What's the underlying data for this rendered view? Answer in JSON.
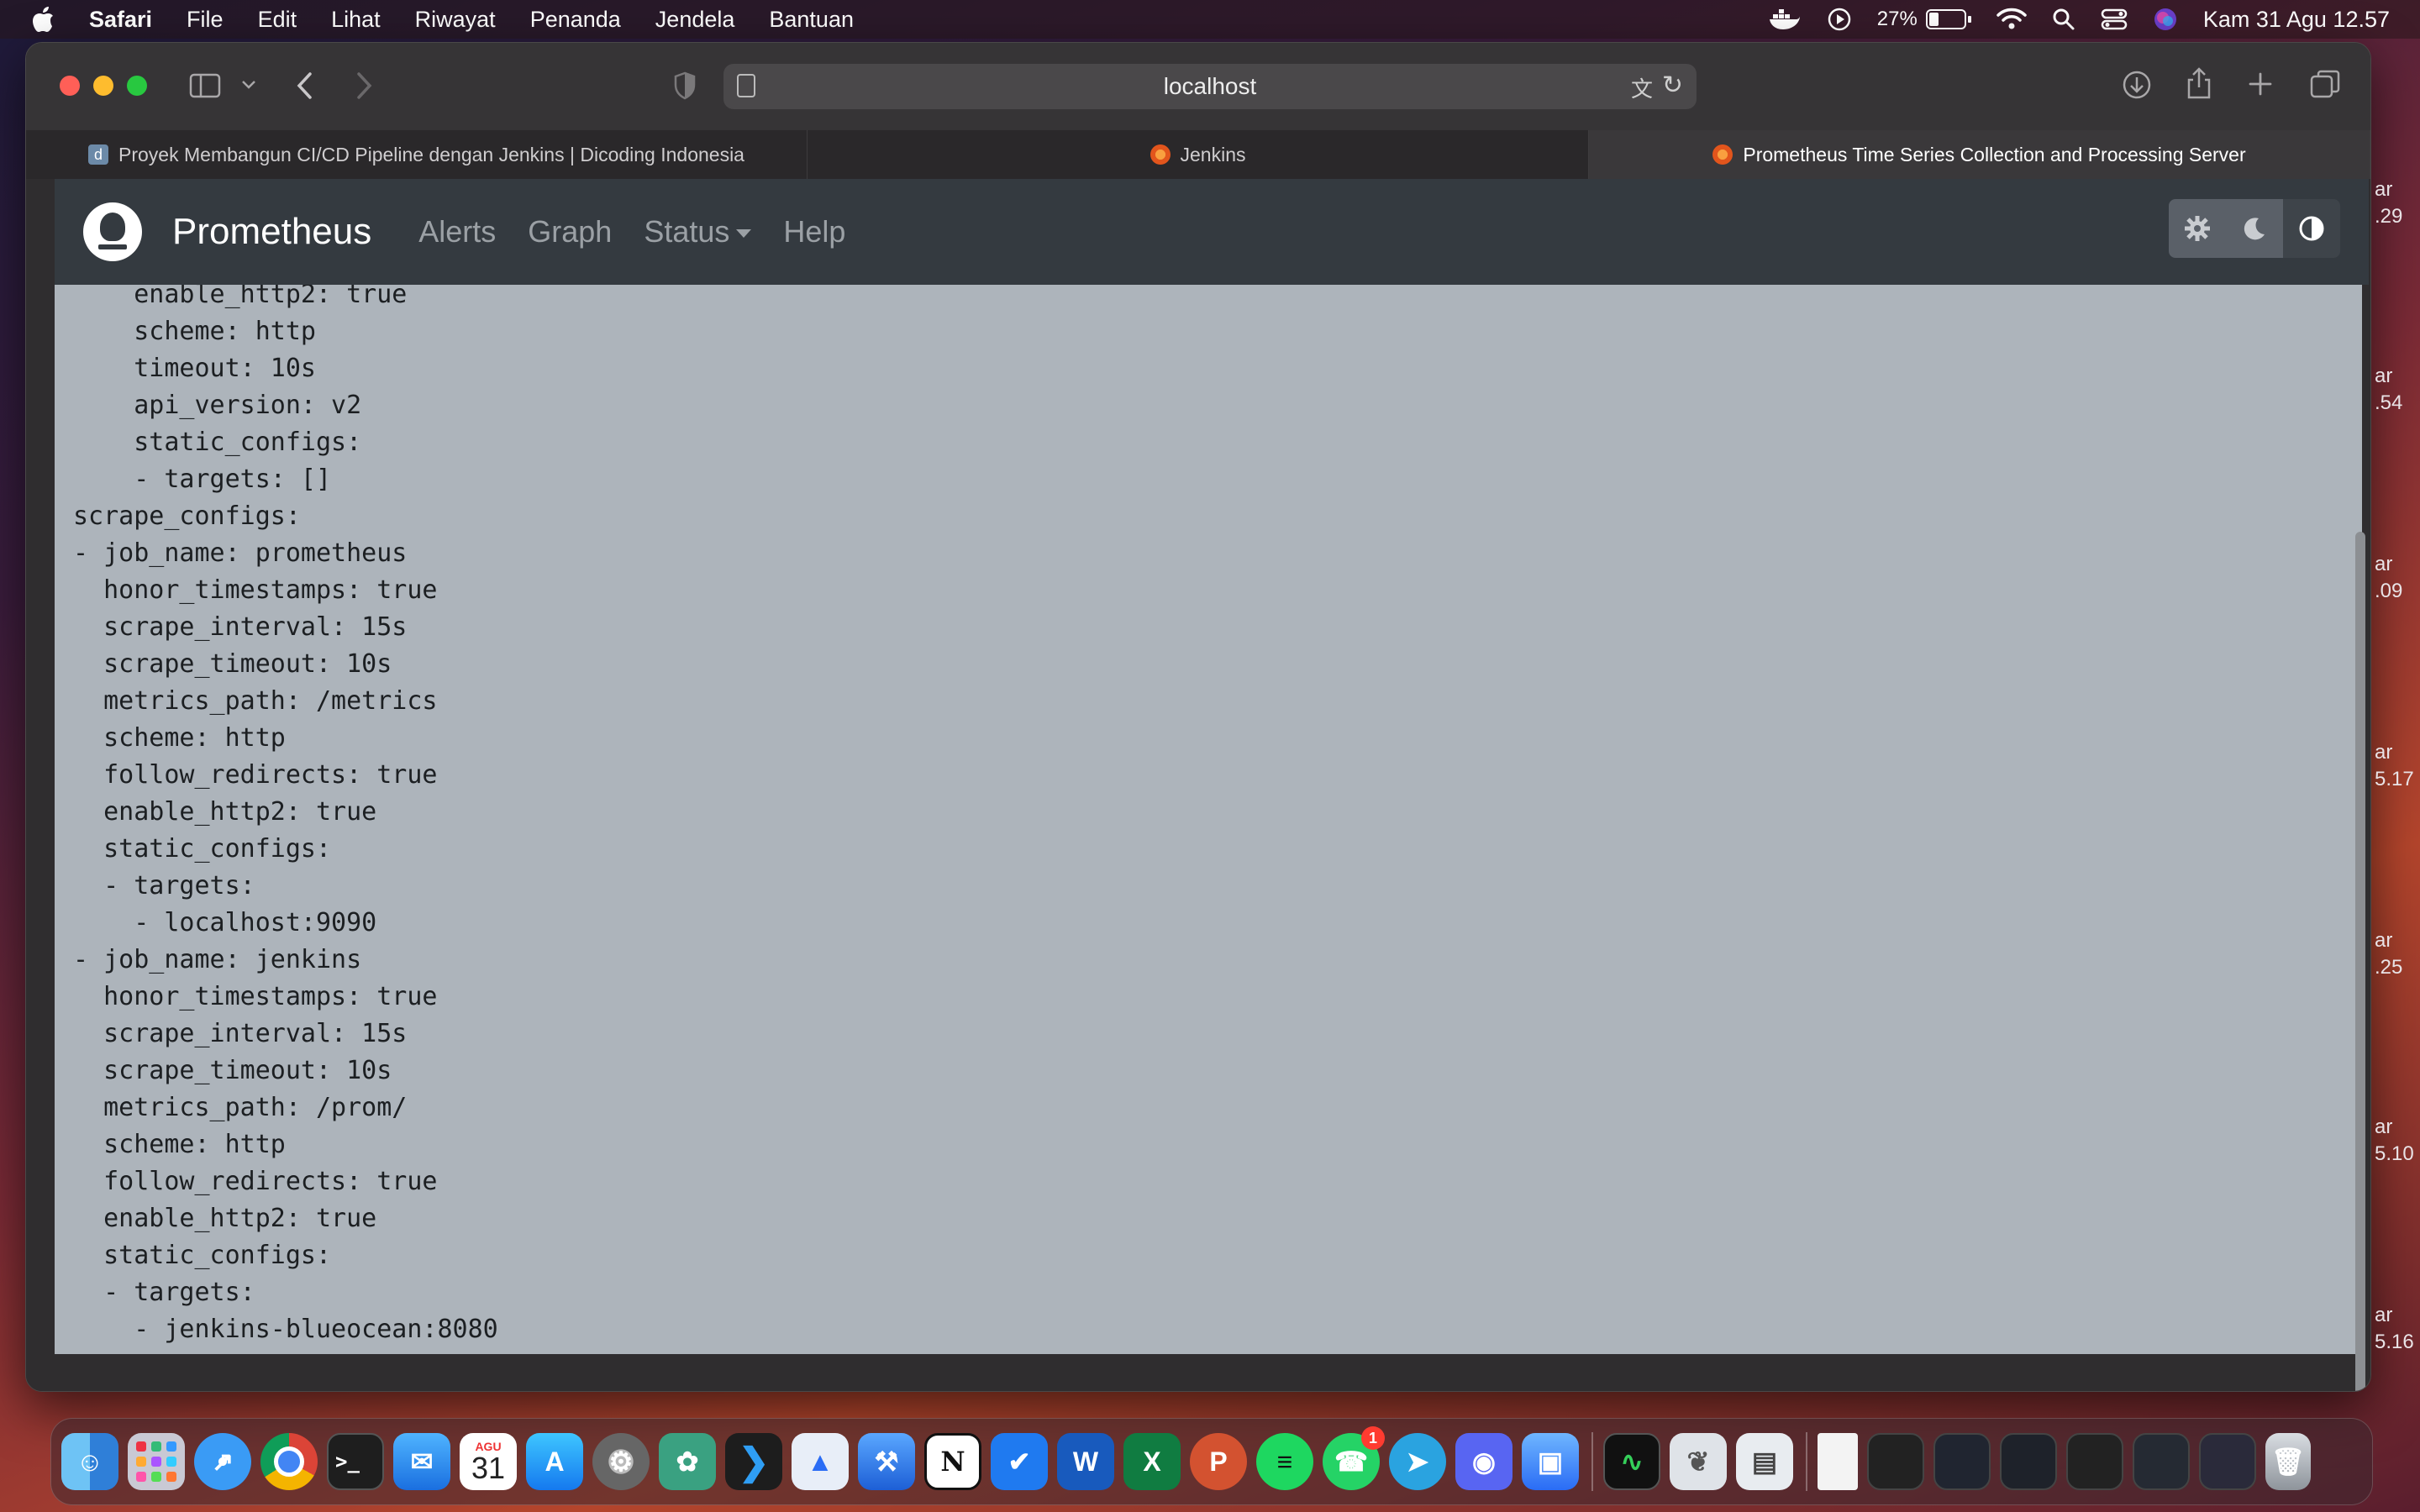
{
  "menubar": {
    "app_name": "Safari",
    "menus": [
      "File",
      "Edit",
      "Lihat",
      "Riwayat",
      "Penanda",
      "Jendela",
      "Bantuan"
    ],
    "battery_percent": "27%",
    "clock": "Kam 31 Agu  12.57"
  },
  "browser": {
    "url": "localhost",
    "tabs": [
      {
        "label": "Proyek Membangun CI/CD Pipeline dengan Jenkins | Dicoding Indonesia",
        "icon": "dicoding-icon",
        "active": false
      },
      {
        "label": "Jenkins",
        "icon": "grafana-icon",
        "active": false
      },
      {
        "label": "Prometheus Time Series Collection and Processing Server",
        "icon": "grafana-icon",
        "active": true
      }
    ]
  },
  "prometheus": {
    "brand": "Prometheus",
    "nav": {
      "alerts": "Alerts",
      "graph": "Graph",
      "status": "Status",
      "help": "Help"
    },
    "theme_buttons": [
      "light-theme-icon",
      "dark-theme-icon",
      "auto-theme-icon"
    ],
    "config_lines": [
      "    enable_http2: true",
      "    scheme: http",
      "    timeout: 10s",
      "    api_version: v2",
      "    static_configs:",
      "    - targets: []",
      "scrape_configs:",
      "- job_name: prometheus",
      "  honor_timestamps: true",
      "  scrape_interval: 15s",
      "  scrape_timeout: 10s",
      "  metrics_path: /metrics",
      "  scheme: http",
      "  follow_redirects: true",
      "  enable_http2: true",
      "  static_configs:",
      "  - targets:",
      "    - localhost:9090",
      "- job_name: jenkins",
      "  honor_timestamps: true",
      "  scrape_interval: 15s",
      "  scrape_timeout: 10s",
      "  metrics_path: /prom/",
      "  scheme: http",
      "  follow_redirects: true",
      "  enable_http2: true",
      "  static_configs:",
      "  - targets:",
      "    - jenkins-blueocean:8080"
    ]
  },
  "background_edge_text": [
    {
      "a": "ar",
      "b": ".29"
    },
    {
      "a": "ar",
      "b": ".54"
    },
    {
      "a": "ar",
      "b": ".09"
    },
    {
      "a": "ar",
      "b": "5.17"
    },
    {
      "a": "ar",
      "b": ".25"
    },
    {
      "a": "ar",
      "b": "5.10"
    },
    {
      "a": "ar",
      "b": "5.16"
    }
  ],
  "dock": {
    "calendar_month": "AGU",
    "calendar_day": "31",
    "whatsapp_badge": "1",
    "apps": [
      "finder-icon",
      "launchpad-icon",
      "safari-icon",
      "chrome-icon",
      "terminal-icon",
      "mail-icon",
      "calendar-icon",
      "app-store-icon",
      "system-settings-icon",
      "chatgpt-icon",
      "vscode-icon",
      "xcode-instruments-icon",
      "xcode-icon",
      "notion-icon",
      "tasks-icon",
      "word-icon",
      "excel-icon",
      "powerpoint-icon",
      "spotify-icon",
      "whatsapp-icon",
      "telegram-icon",
      "discord-icon",
      "simulator-icon",
      "activity-monitor-icon",
      "preview-icon",
      "image-capture-icon",
      "document-thumb-icon",
      "window-thumb-icon",
      "trash-icon"
    ]
  }
}
